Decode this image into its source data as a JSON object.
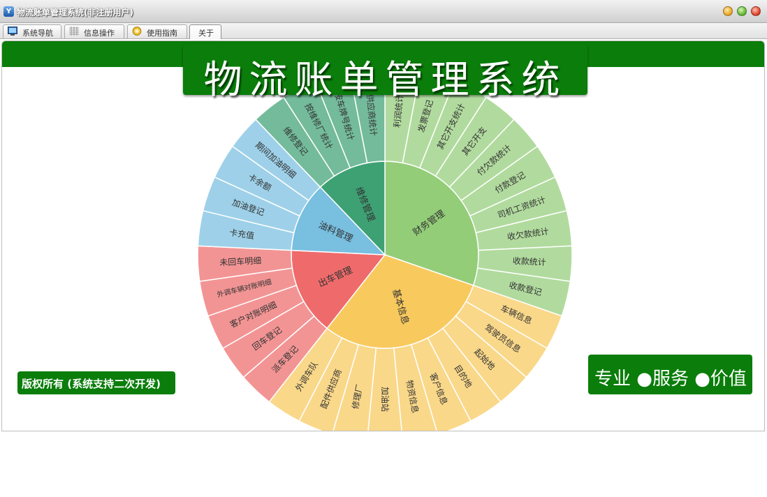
{
  "window": {
    "title": "物流账单管理系统(非注册用户)",
    "icon": "app-logo-icon"
  },
  "tabs": [
    {
      "label": "系统导航",
      "icon": "monitor-icon"
    },
    {
      "label": "信息操作",
      "icon": "grid-icon"
    },
    {
      "label": "使用指南",
      "icon": "help-icon"
    },
    {
      "label": "关于",
      "active": true
    }
  ],
  "banner": {
    "title": "物流账单管理系统"
  },
  "footer": {
    "copyright": "版权所有 (系统支持二次开发)",
    "slogan": "专业 ●服务 ●价值"
  },
  "colors": {
    "brand_green": "#0a7d0a",
    "finance": "#93cd78",
    "basic": "#f8c95d",
    "dispatch": "#ef6b6b",
    "fuel": "#78bfe0",
    "repair": "#3ea174"
  },
  "sunburst": {
    "sectors": [
      {
        "label": "财务管理",
        "color": "#93cd78",
        "children": [
          "利润统计",
          "发票登记",
          "其它开支统计",
          "其它开支",
          "付欠款统计",
          "付款登记",
          "司机工资统计",
          "收欠款统计",
          "收款统计",
          "收款登记"
        ]
      },
      {
        "label": "基本信息",
        "color": "#f8c95d",
        "children": [
          "车辆信息",
          "驾驶员信息",
          "起始地",
          "目的地",
          "客户信息",
          "物资信息",
          "加油站",
          "修理厂",
          "配件供应商",
          "外调车队"
        ]
      },
      {
        "label": "出车管理",
        "color": "#ef6b6b",
        "children": [
          "派车登记",
          "回车登记",
          "客户对账明细",
          "外调车辆对账明细",
          "未回车明细"
        ]
      },
      {
        "label": "油料管理",
        "color": "#78bfe0",
        "children": [
          "卡充值",
          "加油登记",
          "卡余额",
          "期间加油明细"
        ]
      },
      {
        "label": "维修管理",
        "color": "#3ea174",
        "children": [
          "维修登记",
          "按维修厂统计",
          "按车牌号统计",
          "按供应商统计"
        ]
      }
    ]
  }
}
